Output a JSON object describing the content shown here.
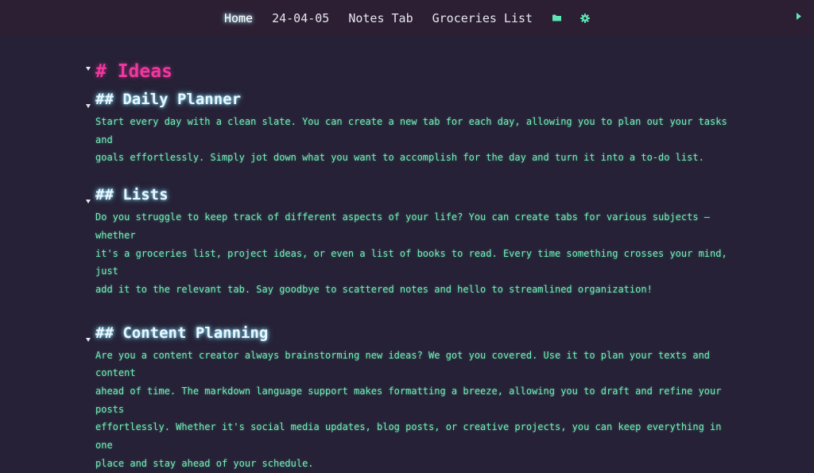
{
  "tabs": [
    {
      "label": "Home",
      "active": true
    },
    {
      "label": "24-04-05",
      "active": false
    },
    {
      "label": "Notes Tab",
      "active": false
    },
    {
      "label": "Groceries List",
      "active": false
    }
  ],
  "icons": {
    "folder": "folder-icon",
    "settings": "gear-icon",
    "expand": "chevron-right-icon",
    "fold": "caret-down-icon"
  },
  "colors": {
    "background": "#262136",
    "topbar": "#2c1f33",
    "heading1": "#f0379e",
    "heading2": "#eaf6ff",
    "body_text": "#70f0b8",
    "icon_accent": "#5ee6b4"
  },
  "document": {
    "title": "# Ideas",
    "sections": [
      {
        "heading": "## Daily Planner",
        "body": "Start every day with a clean slate. You can create a new tab for each day, allowing you to plan out your tasks and\ngoals effortlessly. Simply jot down what you want to accomplish for the day and turn it into a to-do list."
      },
      {
        "heading": "## Lists",
        "body": "Do you struggle to keep track of different aspects of your life? You can create tabs for various subjects — whether\nit's a groceries list, project ideas, or even a list of books to read. Every time something crosses your mind, just\nadd it to the relevant tab. Say goodbye to scattered notes and hello to streamlined organization!"
      },
      {
        "heading": "## Content Planning",
        "body": "Are you a content creator always brainstorming new ideas? We got you covered. Use it to plan your texts and content\nahead of time. The markdown language support makes formatting a breeze, allowing you to draft and refine your posts\neffortlessly. Whether it's social media updates, blog posts, or creative projects, you can keep everything in one\nplace and stay ahead of your schedule."
      }
    ]
  }
}
